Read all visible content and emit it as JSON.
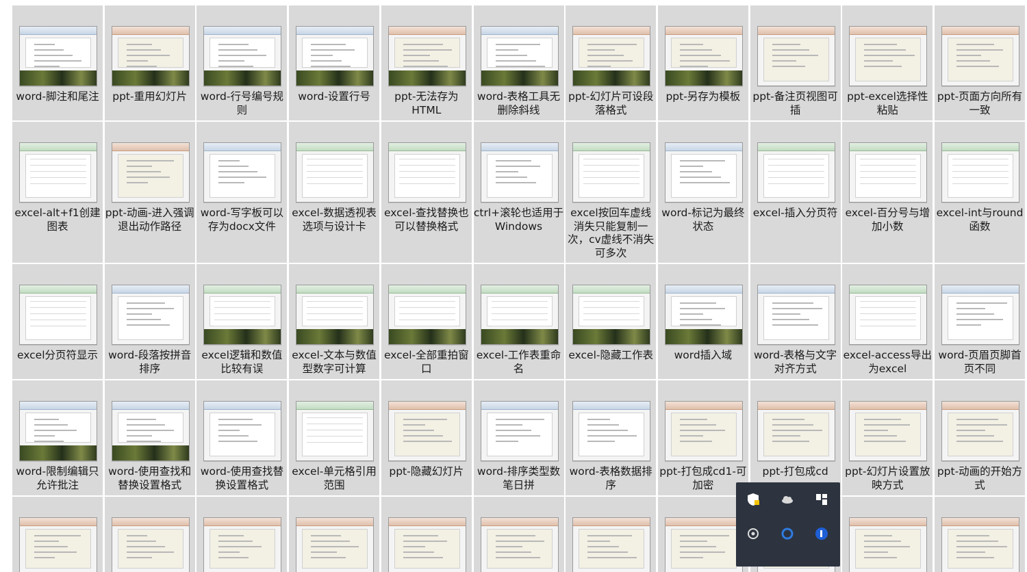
{
  "tiles": [
    {
      "label": "word-脚注和尾注",
      "app": "word",
      "photo": true
    },
    {
      "label": "ppt-重用幻灯片",
      "app": "ppt",
      "photo": true
    },
    {
      "label": "word-行号编号规则",
      "app": "word",
      "photo": true
    },
    {
      "label": "word-设置行号",
      "app": "word",
      "photo": true
    },
    {
      "label": "ppt-无法存为HTML",
      "app": "ppt",
      "photo": true
    },
    {
      "label": "word-表格工具无删除斜线",
      "app": "word",
      "photo": true
    },
    {
      "label": "ppt-幻灯片可设段落格式",
      "app": "ppt",
      "photo": true
    },
    {
      "label": "ppt-另存为模板",
      "app": "ppt",
      "photo": true
    },
    {
      "label": "ppt-备注页视图可插",
      "app": "ppt",
      "photo": false
    },
    {
      "label": "ppt-excel选择性粘贴",
      "app": "ppt",
      "photo": false
    },
    {
      "label": "ppt-页面方向所有一致",
      "app": "ppt",
      "photo": false
    },
    {
      "label": "excel-alt+f1创建图表",
      "app": "excel",
      "photo": false
    },
    {
      "label": "ppt-动画-进入强调退出动作路径",
      "app": "ppt",
      "photo": false
    },
    {
      "label": "word-写字板可以存为docx文件",
      "app": "word",
      "photo": false
    },
    {
      "label": "excel-数据透视表选项与设计卡",
      "app": "excel",
      "photo": false
    },
    {
      "label": "excel-查找替换也可以替换格式",
      "app": "excel",
      "photo": false
    },
    {
      "label": "ctrl+滚轮也适用于Windows",
      "app": "word",
      "photo": false
    },
    {
      "label": "excel按回车虚线消失只能复制一次，cv虚线不消失可多次",
      "app": "excel",
      "photo": false
    },
    {
      "label": "word-标记为最终状态",
      "app": "word",
      "photo": false
    },
    {
      "label": "excel-插入分页符",
      "app": "excel",
      "photo": false
    },
    {
      "label": "excel-百分号与增加小数",
      "app": "excel",
      "photo": false
    },
    {
      "label": "excel-int与round函数",
      "app": "excel",
      "photo": false
    },
    {
      "label": "excel分页符显示",
      "app": "excel",
      "photo": false
    },
    {
      "label": "word-段落按拼音排序",
      "app": "word",
      "photo": false
    },
    {
      "label": "excel逻辑和数值比较有误",
      "app": "excel",
      "photo": true
    },
    {
      "label": "excel-文本与数值型数字可计算",
      "app": "excel",
      "photo": true
    },
    {
      "label": "excel-全部重拍窗口",
      "app": "excel",
      "photo": true
    },
    {
      "label": "excel-工作表重命名",
      "app": "excel",
      "photo": true
    },
    {
      "label": "excel-隐藏工作表",
      "app": "excel",
      "photo": true
    },
    {
      "label": "word插入域",
      "app": "word",
      "photo": true
    },
    {
      "label": "word-表格与文字对齐方式",
      "app": "word",
      "photo": false
    },
    {
      "label": "excel-access导出为excel",
      "app": "excel",
      "photo": false
    },
    {
      "label": "word-页眉页脚首页不同",
      "app": "word",
      "photo": false
    },
    {
      "label": "word-限制编辑只允许批注",
      "app": "word",
      "photo": true
    },
    {
      "label": "word-使用查找和替换设置格式",
      "app": "word",
      "photo": true
    },
    {
      "label": "word-使用查找替换设置格式",
      "app": "word",
      "photo": false
    },
    {
      "label": "excel-单元格引用范围",
      "app": "excel",
      "photo": false
    },
    {
      "label": "ppt-隐藏幻灯片",
      "app": "ppt",
      "photo": false
    },
    {
      "label": "word-排序类型数笔日拼",
      "app": "word",
      "photo": false
    },
    {
      "label": "word-表格数据排序",
      "app": "word",
      "photo": false
    },
    {
      "label": "ppt-打包成cd1-可加密",
      "app": "ppt",
      "photo": false
    },
    {
      "label": "ppt-打包成cd",
      "app": "ppt",
      "photo": false
    },
    {
      "label": "ppt-幻灯片设置放映方式",
      "app": "ppt",
      "photo": false
    },
    {
      "label": "ppt-动画的开始方式",
      "app": "ppt",
      "photo": false
    },
    {
      "label": "",
      "app": "ppt",
      "photo": false
    },
    {
      "label": "",
      "app": "ppt",
      "photo": false
    },
    {
      "label": "",
      "app": "ppt",
      "photo": false
    },
    {
      "label": "",
      "app": "ppt",
      "photo": false
    },
    {
      "label": "",
      "app": "ppt",
      "photo": false
    },
    {
      "label": "",
      "app": "ppt",
      "photo": false
    },
    {
      "label": "",
      "app": "ppt",
      "photo": false
    },
    {
      "label": "",
      "app": "ppt",
      "photo": false
    },
    {
      "label": "",
      "app": "ppt",
      "photo": false
    },
    {
      "label": "",
      "app": "ppt",
      "photo": false
    },
    {
      "label": "",
      "app": "ppt",
      "photo": false
    }
  ],
  "tray": {
    "icons": [
      "shield-warning-icon",
      "onedrive-cloud-icon",
      "snap-layout-icon",
      "settings-gear-icon",
      "edge-ring-icon",
      "onedrive-blue-icon"
    ]
  }
}
